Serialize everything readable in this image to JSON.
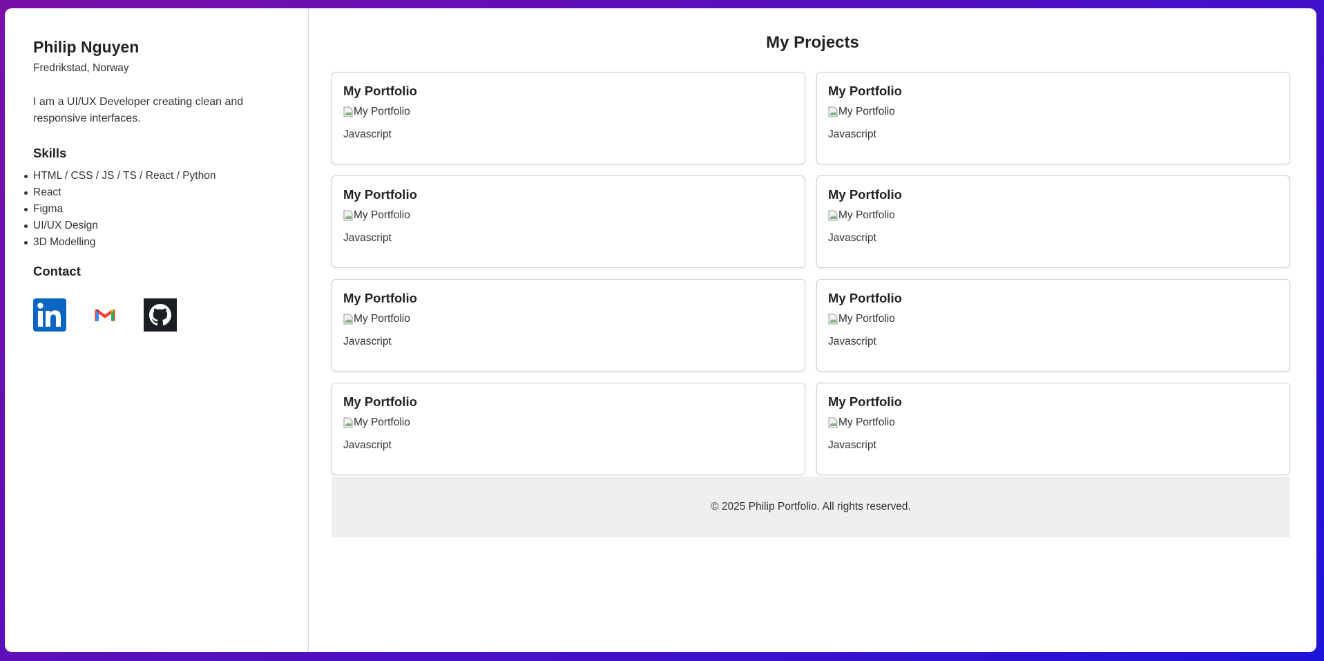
{
  "sidebar": {
    "name": "Philip Nguyen",
    "location": "Fredrikstad, Norway",
    "bio": "I am a UI/UX Developer creating clean and responsive interfaces.",
    "skills_heading": "Skills",
    "skills": [
      "HTML / CSS / JS / TS / React / Python",
      "React",
      "Figma",
      "UI/UX Design",
      "3D Modelling"
    ],
    "contact_heading": "Contact",
    "contacts": [
      {
        "icon": "linkedin-icon",
        "color": "#0a66c2"
      },
      {
        "icon": "gmail-icon",
        "color": "#ea4335"
      },
      {
        "icon": "github-icon",
        "color": "#1b1f23"
      }
    ]
  },
  "main": {
    "title": "My Projects",
    "projects": [
      {
        "title": "My Portfolio",
        "image_alt": "My Portfolio",
        "tag": "Javascript"
      },
      {
        "title": "My Portfolio",
        "image_alt": "My Portfolio",
        "tag": "Javascript"
      },
      {
        "title": "My Portfolio",
        "image_alt": "My Portfolio",
        "tag": "Javascript"
      },
      {
        "title": "My Portfolio",
        "image_alt": "My Portfolio",
        "tag": "Javascript"
      },
      {
        "title": "My Portfolio",
        "image_alt": "My Portfolio",
        "tag": "Javascript"
      },
      {
        "title": "My Portfolio",
        "image_alt": "My Portfolio",
        "tag": "Javascript"
      },
      {
        "title": "My Portfolio",
        "image_alt": "My Portfolio",
        "tag": "Javascript"
      },
      {
        "title": "My Portfolio",
        "image_alt": "My Portfolio",
        "tag": "Javascript"
      }
    ]
  },
  "footer": {
    "text": "© 2025 Philip Portfolio. All rights reserved."
  },
  "colors": {
    "background_gradient_start": "#7a0fa8",
    "background_gradient_end": "#1e14d8",
    "card_border": "#cfcfcf",
    "footer_bg": "#efefef"
  }
}
